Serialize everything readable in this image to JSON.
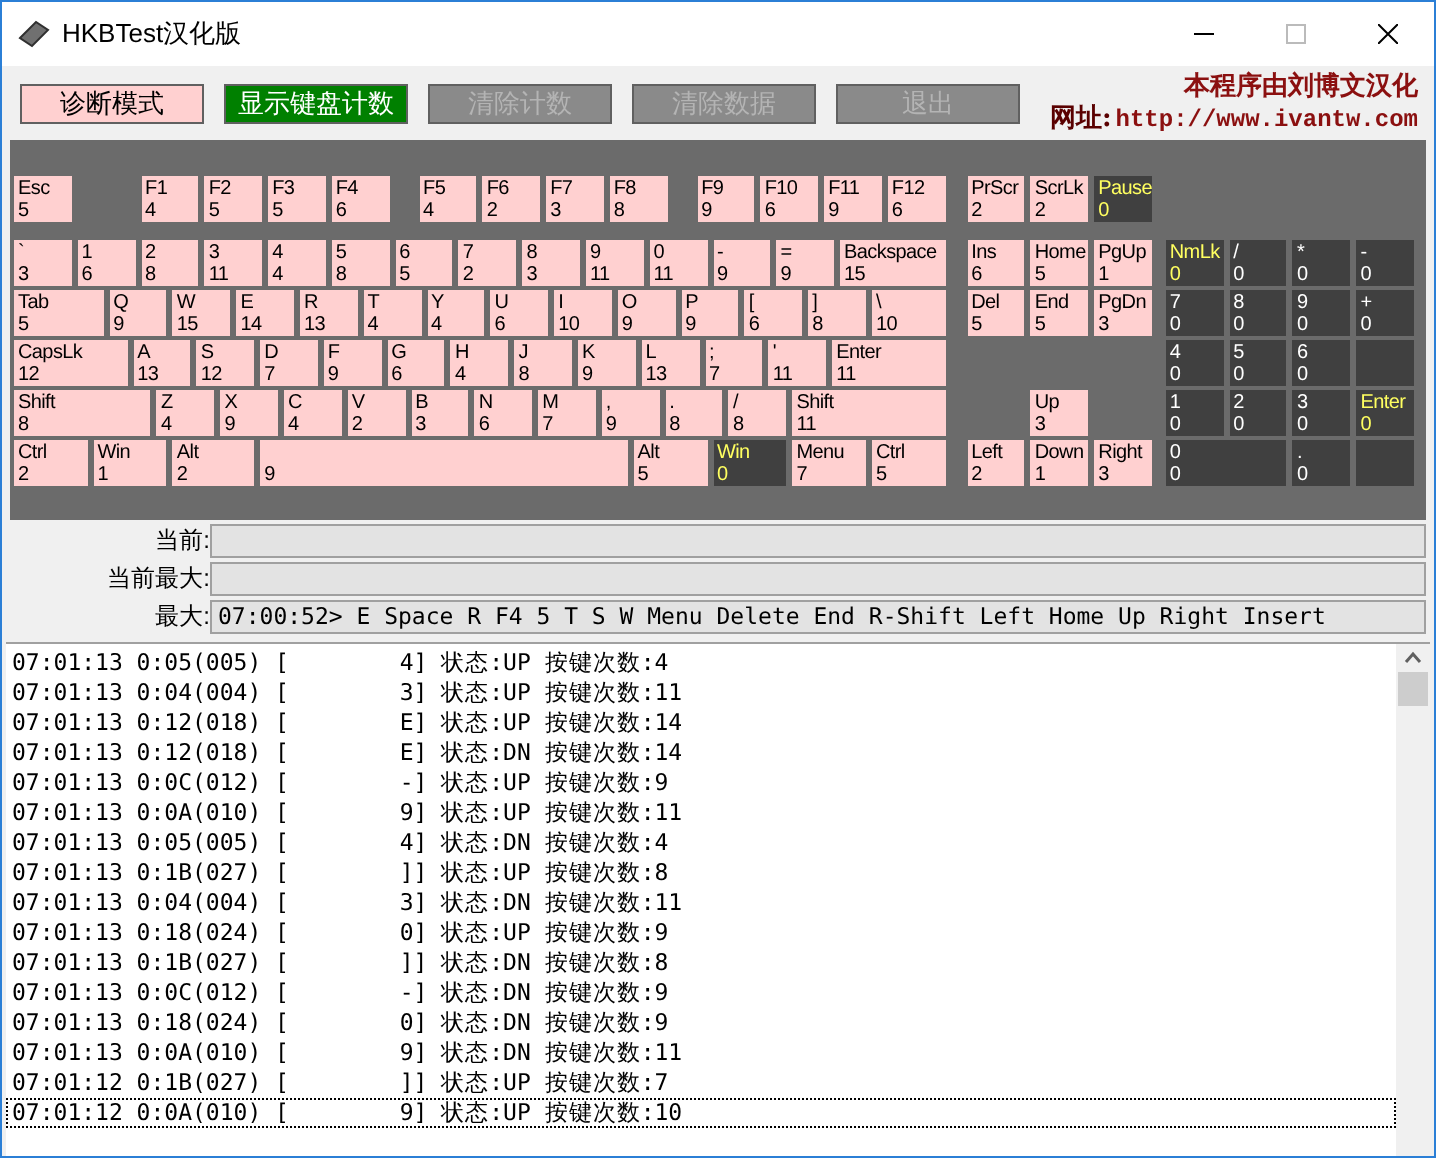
{
  "window": {
    "title": "HKBTest汉化版"
  },
  "toolbar": {
    "buttons": [
      {
        "label": "诊断模式",
        "kind": "pink"
      },
      {
        "label": "显示键盘计数",
        "kind": "green"
      },
      {
        "label": "清除计数",
        "kind": "disabled"
      },
      {
        "label": "清除数据",
        "kind": "disabled"
      },
      {
        "label": "退出",
        "kind": "disabled"
      }
    ],
    "credit": "本程序由刘博文汉化",
    "site_label": "网址:",
    "site_url": "http://www.ivantw.com"
  },
  "keyboard": {
    "keys": [
      {
        "label": "Esc",
        "count": "5",
        "kind": "used"
      },
      {
        "label": "F1",
        "count": "4",
        "kind": "used"
      },
      {
        "label": "F2",
        "count": "5",
        "kind": "used"
      },
      {
        "label": "F3",
        "count": "5",
        "kind": "used"
      },
      {
        "label": "F4",
        "count": "6",
        "kind": "used"
      },
      {
        "label": "F5",
        "count": "4",
        "kind": "used"
      },
      {
        "label": "F6",
        "count": "2",
        "kind": "used"
      },
      {
        "label": "F7",
        "count": "3",
        "kind": "used"
      },
      {
        "label": "F8",
        "count": "8",
        "kind": "used"
      },
      {
        "label": "F9",
        "count": "9",
        "kind": "used"
      },
      {
        "label": "F10",
        "count": "6",
        "kind": "used"
      },
      {
        "label": "F11",
        "count": "9",
        "kind": "used"
      },
      {
        "label": "F12",
        "count": "6",
        "kind": "used"
      },
      {
        "label": "PrScr",
        "count": "2",
        "kind": "used"
      },
      {
        "label": "ScrLk",
        "count": "2",
        "kind": "used"
      },
      {
        "label": "Pause",
        "count": "0",
        "kind": "special"
      },
      {
        "label": "`",
        "count": "3",
        "kind": "used"
      },
      {
        "label": "1",
        "count": "6",
        "kind": "used"
      },
      {
        "label": "2",
        "count": "8",
        "kind": "used"
      },
      {
        "label": "3",
        "count": "11",
        "kind": "used"
      },
      {
        "label": "4",
        "count": "4",
        "kind": "used"
      },
      {
        "label": "5",
        "count": "8",
        "kind": "used"
      },
      {
        "label": "6",
        "count": "5",
        "kind": "used"
      },
      {
        "label": "7",
        "count": "2",
        "kind": "used"
      },
      {
        "label": "8",
        "count": "3",
        "kind": "used"
      },
      {
        "label": "9",
        "count": "11",
        "kind": "used"
      },
      {
        "label": "0",
        "count": "11",
        "kind": "used"
      },
      {
        "label": "-",
        "count": "9",
        "kind": "used"
      },
      {
        "label": "=",
        "count": "9",
        "kind": "used"
      },
      {
        "label": "Backspace",
        "count": "15",
        "kind": "used"
      },
      {
        "label": "Ins",
        "count": "6",
        "kind": "used"
      },
      {
        "label": "Home",
        "count": "5",
        "kind": "used"
      },
      {
        "label": "PgUp",
        "count": "1",
        "kind": "used"
      },
      {
        "label": "NmLk",
        "count": "0",
        "kind": "special"
      },
      {
        "label": "/",
        "count": "0",
        "kind": "unused"
      },
      {
        "label": "*",
        "count": "0",
        "kind": "unused"
      },
      {
        "label": "-",
        "count": "0",
        "kind": "unused"
      },
      {
        "label": "Tab",
        "count": "5",
        "kind": "used"
      },
      {
        "label": "Q",
        "count": "9",
        "kind": "used"
      },
      {
        "label": "W",
        "count": "15",
        "kind": "used"
      },
      {
        "label": "E",
        "count": "14",
        "kind": "used"
      },
      {
        "label": "R",
        "count": "13",
        "kind": "used"
      },
      {
        "label": "T",
        "count": "4",
        "kind": "used"
      },
      {
        "label": "Y",
        "count": "4",
        "kind": "used"
      },
      {
        "label": "U",
        "count": "6",
        "kind": "used"
      },
      {
        "label": "I",
        "count": "10",
        "kind": "used"
      },
      {
        "label": "O",
        "count": "9",
        "kind": "used"
      },
      {
        "label": "P",
        "count": "9",
        "kind": "used"
      },
      {
        "label": "[",
        "count": "6",
        "kind": "used"
      },
      {
        "label": "]",
        "count": "8",
        "kind": "used"
      },
      {
        "label": "\\",
        "count": "10",
        "kind": "used"
      },
      {
        "label": "Del",
        "count": "5",
        "kind": "used"
      },
      {
        "label": "End",
        "count": "5",
        "kind": "used"
      },
      {
        "label": "PgDn",
        "count": "3",
        "kind": "used"
      },
      {
        "label": "7",
        "count": "0",
        "kind": "unused"
      },
      {
        "label": "8",
        "count": "0",
        "kind": "unused"
      },
      {
        "label": "9",
        "count": "0",
        "kind": "unused"
      },
      {
        "label": "+",
        "count": "0",
        "kind": "unused"
      },
      {
        "label": "CapsLk",
        "count": "12",
        "kind": "used"
      },
      {
        "label": "A",
        "count": "13",
        "kind": "used"
      },
      {
        "label": "S",
        "count": "12",
        "kind": "used"
      },
      {
        "label": "D",
        "count": "7",
        "kind": "used"
      },
      {
        "label": "F",
        "count": "9",
        "kind": "used"
      },
      {
        "label": "G",
        "count": "6",
        "kind": "used"
      },
      {
        "label": "H",
        "count": "4",
        "kind": "used"
      },
      {
        "label": "J",
        "count": "8",
        "kind": "used"
      },
      {
        "label": "K",
        "count": "9",
        "kind": "used"
      },
      {
        "label": "L",
        "count": "13",
        "kind": "used"
      },
      {
        "label": ";",
        "count": "7",
        "kind": "used"
      },
      {
        "label": "'",
        "count": "11",
        "kind": "used"
      },
      {
        "label": "Enter",
        "count": "11",
        "kind": "used"
      },
      {
        "label": "4",
        "count": "0",
        "kind": "unused"
      },
      {
        "label": "5",
        "count": "0",
        "kind": "unused"
      },
      {
        "label": "6",
        "count": "0",
        "kind": "unused"
      },
      {
        "label": "Shift",
        "count": "8",
        "kind": "used"
      },
      {
        "label": "Z",
        "count": "4",
        "kind": "used"
      },
      {
        "label": "X",
        "count": "9",
        "kind": "used"
      },
      {
        "label": "C",
        "count": "4",
        "kind": "used"
      },
      {
        "label": "V",
        "count": "2",
        "kind": "used"
      },
      {
        "label": "B",
        "count": "3",
        "kind": "used"
      },
      {
        "label": "N",
        "count": "6",
        "kind": "used"
      },
      {
        "label": "M",
        "count": "7",
        "kind": "used"
      },
      {
        "label": ",",
        "count": "9",
        "kind": "used"
      },
      {
        "label": ".",
        "count": "8",
        "kind": "used"
      },
      {
        "label": "/",
        "count": "8",
        "kind": "used"
      },
      {
        "label": "Shift",
        "count": "11",
        "kind": "used"
      },
      {
        "label": "Up",
        "count": "3",
        "kind": "used"
      },
      {
        "label": "1",
        "count": "0",
        "kind": "unused"
      },
      {
        "label": "2",
        "count": "0",
        "kind": "unused"
      },
      {
        "label": "3",
        "count": "0",
        "kind": "unused"
      },
      {
        "label": "Enter",
        "count": "0",
        "kind": "special"
      },
      {
        "label": "Ctrl",
        "count": "2",
        "kind": "used"
      },
      {
        "label": "Win",
        "count": "1",
        "kind": "used"
      },
      {
        "label": "Alt",
        "count": "2",
        "kind": "used"
      },
      {
        "count": "9",
        "kind": "used"
      },
      {
        "label": "Alt",
        "count": "5",
        "kind": "used"
      },
      {
        "label": "Win",
        "count": "0",
        "kind": "special"
      },
      {
        "label": "Menu",
        "count": "7",
        "kind": "used"
      },
      {
        "label": "Ctrl",
        "count": "5",
        "kind": "used"
      },
      {
        "label": "Left",
        "count": "2",
        "kind": "used"
      },
      {
        "label": "Down",
        "count": "1",
        "kind": "used"
      },
      {
        "label": "Right",
        "count": "3",
        "kind": "used"
      },
      {
        "label": "0",
        "count": "0",
        "kind": "unused"
      },
      {
        "label": ".",
        "count": "0",
        "kind": "unused"
      }
    ]
  },
  "info": [
    {
      "label": "当前:"
    },
    {
      "label": "当前最大:"
    },
    {
      "label": "最大:",
      "value": "07:00:52> E Space R F4 5 T S W Menu Delete End R-Shift Left Home Up Right Insert"
    }
  ],
  "log": [
    {
      "text": "07:01:13 0:05(005) [        4] 状态:UP 按键次数:4",
      "focused": false
    },
    {
      "text": "07:01:13 0:04(004) [        3] 状态:UP 按键次数:11",
      "focused": false
    },
    {
      "text": "07:01:13 0:12(018) [        E] 状态:UP 按键次数:14",
      "focused": false
    },
    {
      "text": "07:01:13 0:12(018) [        E] 状态:DN 按键次数:14",
      "focused": false
    },
    {
      "text": "07:01:13 0:0C(012) [        -] 状态:UP 按键次数:9",
      "focused": false
    },
    {
      "text": "07:01:13 0:0A(010) [        9] 状态:UP 按键次数:11",
      "focused": false
    },
    {
      "text": "07:01:13 0:05(005) [        4] 状态:DN 按键次数:4",
      "focused": false
    },
    {
      "text": "07:01:13 0:1B(027) [        ]] 状态:UP 按键次数:8",
      "focused": false
    },
    {
      "text": "07:01:13 0:04(004) [        3] 状态:DN 按键次数:11",
      "focused": false
    },
    {
      "text": "07:01:13 0:18(024) [        0] 状态:UP 按键次数:9",
      "focused": false
    },
    {
      "text": "07:01:13 0:1B(027) [        ]] 状态:DN 按键次数:8",
      "focused": false
    },
    {
      "text": "07:01:13 0:0C(012) [        -] 状态:DN 按键次数:9",
      "focused": false
    },
    {
      "text": "07:01:13 0:18(024) [        0] 状态:DN 按键次数:9",
      "focused": false
    },
    {
      "text": "07:01:13 0:0A(010) [        9] 状态:DN 按键次数:11",
      "focused": false
    },
    {
      "text": "07:01:12 0:1B(027) [        ]] 状态:UP 按键次数:7",
      "focused": false
    },
    {
      "text": "07:01:12 0:0A(010) [        9] 状态:UP 按键次数:10",
      "focused": true
    }
  ]
}
